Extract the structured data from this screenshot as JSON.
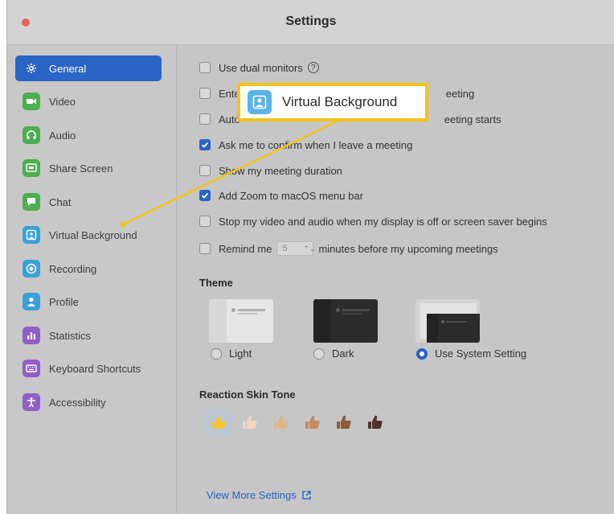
{
  "window": {
    "title": "Settings"
  },
  "sidebar": {
    "items": [
      {
        "label": "General",
        "icon": "gear-icon",
        "color": "#2a64c4",
        "active": true
      },
      {
        "label": "Video",
        "icon": "video-camera-icon",
        "color": "#4caf50"
      },
      {
        "label": "Audio",
        "icon": "headphones-icon",
        "color": "#4caf50"
      },
      {
        "label": "Share Screen",
        "icon": "share-screen-icon",
        "color": "#4caf50"
      },
      {
        "label": "Chat",
        "icon": "chat-bubble-icon",
        "color": "#4caf50"
      },
      {
        "label": "Virtual Background",
        "icon": "virtual-background-icon",
        "color": "#3aa0d8"
      },
      {
        "label": "Recording",
        "icon": "record-icon",
        "color": "#3aa0d8"
      },
      {
        "label": "Profile",
        "icon": "profile-icon",
        "color": "#3aa0d8"
      },
      {
        "label": "Statistics",
        "icon": "statistics-icon",
        "color": "#8e5fc9"
      },
      {
        "label": "Keyboard Shortcuts",
        "icon": "keyboard-icon",
        "color": "#8e5fc9"
      },
      {
        "label": "Accessibility",
        "icon": "accessibility-icon",
        "color": "#8e5fc9"
      }
    ]
  },
  "general": {
    "options": [
      {
        "label": "Use dual monitors",
        "checked": false,
        "help": true
      },
      {
        "label": "Ente",
        "suffix": "eeting",
        "checked": false
      },
      {
        "label": "Auto",
        "suffix": "eeting starts",
        "checked": false
      },
      {
        "label": "Ask me to confirm when I leave a meeting",
        "checked": true
      },
      {
        "label": "Show my meeting duration",
        "checked": false
      },
      {
        "label": "Add Zoom to macOS menu bar",
        "checked": true
      },
      {
        "label": "Stop my video and audio when my display is off or screen saver begins",
        "checked": false
      }
    ],
    "remind": {
      "prefix": "Remind me",
      "value": "5",
      "suffix": "minutes before my upcoming meetings",
      "checked": false
    },
    "help_symbol": "?",
    "stepper_arrows": "⌃⌄",
    "theme": {
      "title": "Theme",
      "options": [
        {
          "label": "Light",
          "selected": false
        },
        {
          "label": "Dark",
          "selected": false
        },
        {
          "label": "Use System Setting",
          "selected": true
        }
      ]
    },
    "skin_tone": {
      "title": "Reaction Skin Tone",
      "tones": [
        "#f4c430",
        "#f2d6bf",
        "#e0b58d",
        "#c58d5f",
        "#8d5a3b",
        "#4e342a"
      ],
      "selected_index": 0
    },
    "view_more_label": "View More Settings"
  },
  "callout": {
    "label": "Virtual Background",
    "border_color": "#f2c418"
  },
  "colors": {
    "accent": "#2a64c4",
    "highlight": "#f2c418"
  }
}
